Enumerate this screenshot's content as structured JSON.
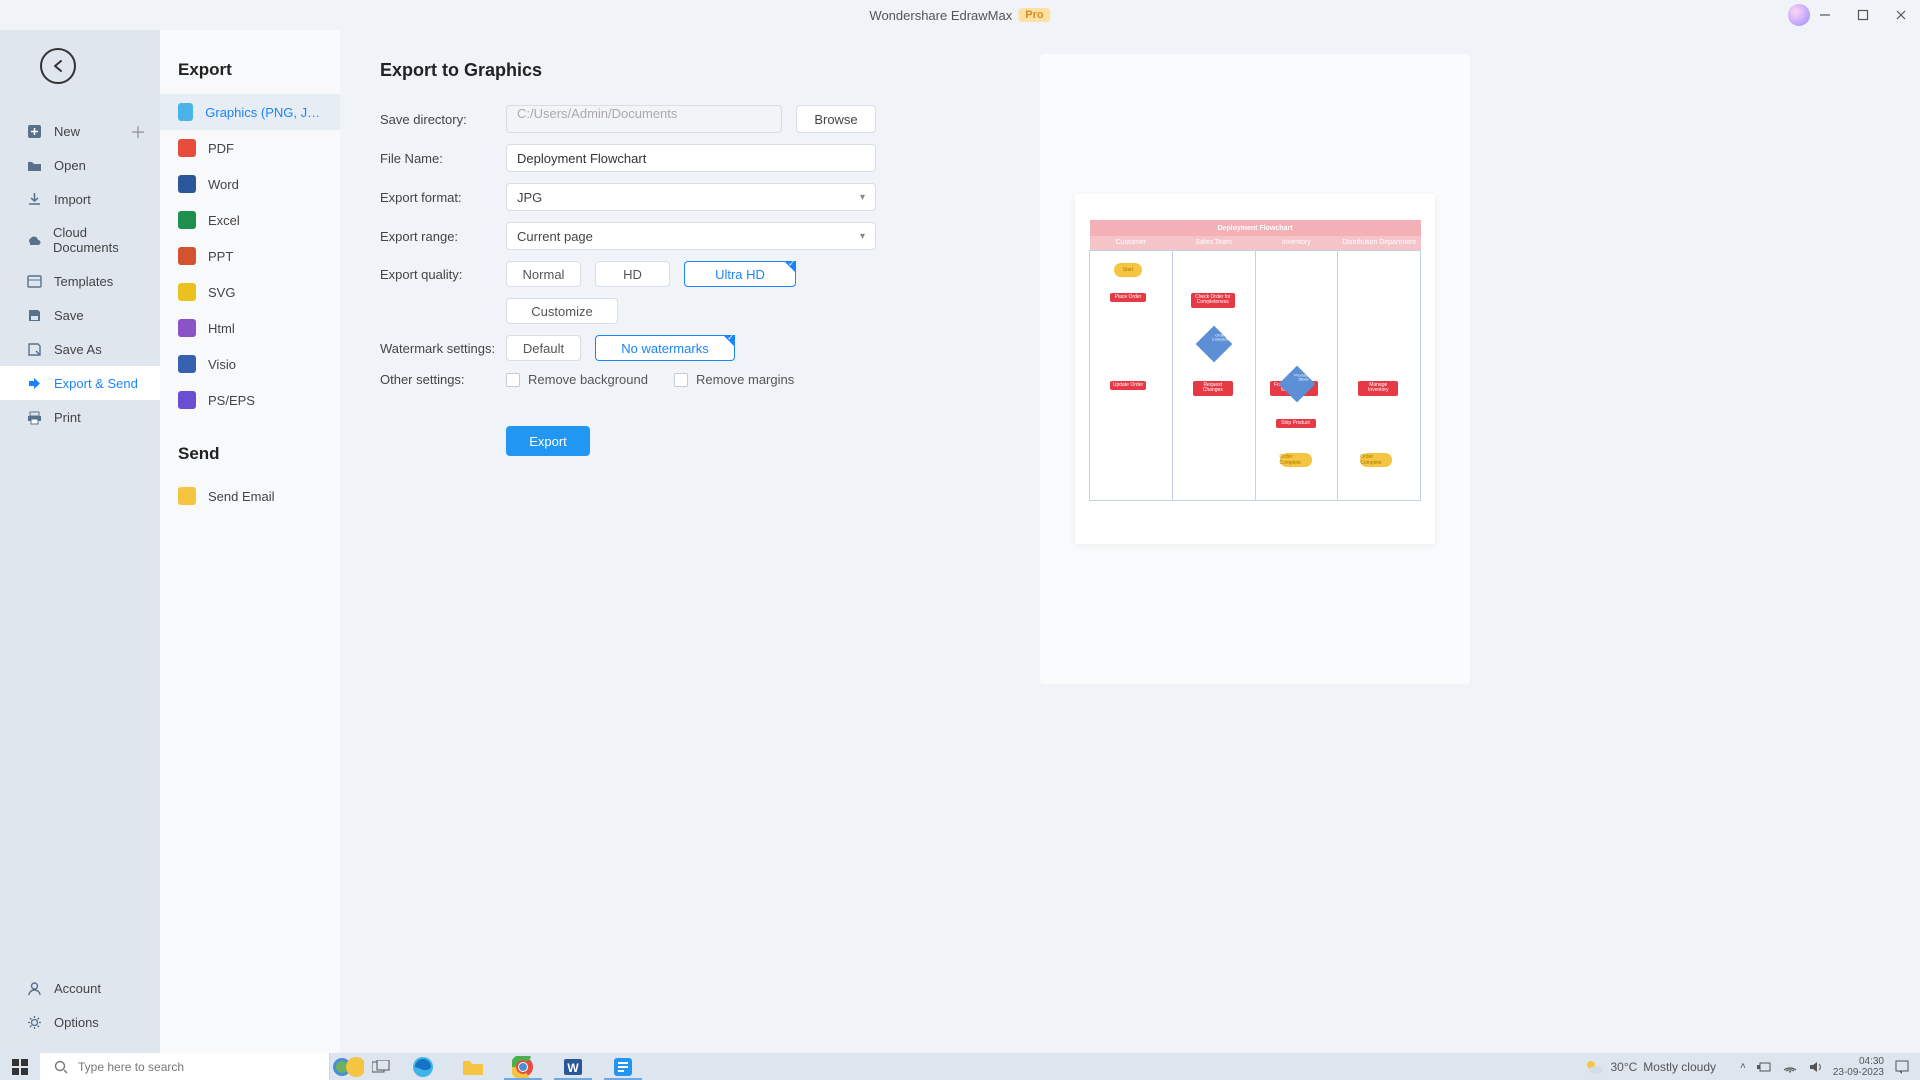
{
  "title": {
    "app": "Wondershare EdrawMax",
    "badge": "Pro"
  },
  "sidebar": {
    "items": [
      {
        "label": "New"
      },
      {
        "label": "Open"
      },
      {
        "label": "Import"
      },
      {
        "label": "Cloud Documents"
      },
      {
        "label": "Templates"
      },
      {
        "label": "Save"
      },
      {
        "label": "Save As"
      },
      {
        "label": "Export & Send"
      },
      {
        "label": "Print"
      }
    ],
    "account": "Account",
    "options": "Options"
  },
  "second_panel": {
    "export_header": "Export",
    "send_header": "Send",
    "formats": [
      {
        "label": "Graphics (PNG, JPG e...",
        "color": "#4cb3e8"
      },
      {
        "label": "PDF",
        "color": "#e74c3c"
      },
      {
        "label": "Word",
        "color": "#2b579a"
      },
      {
        "label": "Excel",
        "color": "#1d8f4e"
      },
      {
        "label": "PPT",
        "color": "#d35230"
      },
      {
        "label": "SVG",
        "color": "#eac11e"
      },
      {
        "label": "Html",
        "color": "#8a53c7"
      },
      {
        "label": "Visio",
        "color": "#3860b0"
      },
      {
        "label": "PS/EPS",
        "color": "#6a4fd1"
      }
    ],
    "send_email": "Send Email"
  },
  "content": {
    "title": "Export to Graphics",
    "labels": {
      "save_dir": "Save directory:",
      "file_name": "File Name:",
      "format": "Export format:",
      "range": "Export range:",
      "quality": "Export quality:",
      "watermark": "Watermark settings:",
      "other": "Other settings:"
    },
    "values": {
      "save_dir": "C:/Users/Admin/Documents",
      "browse": "Browse",
      "file_name": "Deployment Flowchart",
      "format": "JPG",
      "range": "Current page",
      "quality": {
        "normal": "Normal",
        "hd": "HD",
        "ultra": "Ultra HD"
      },
      "customize": "Customize",
      "watermark": {
        "default": "Default",
        "none": "No watermarks"
      },
      "remove_bg": "Remove background",
      "remove_margins": "Remove margins",
      "export": "Export"
    }
  },
  "preview": {
    "title": "Deployment Flowchart",
    "cols": [
      "Customer",
      "Sales Team",
      "Inventory",
      "Distribution Department"
    ]
  },
  "taskbar": {
    "search": "Type here to search",
    "weather_temp": "30°C",
    "weather_desc": "Mostly cloudy",
    "time": "04:30",
    "date": "23-09-2023"
  }
}
